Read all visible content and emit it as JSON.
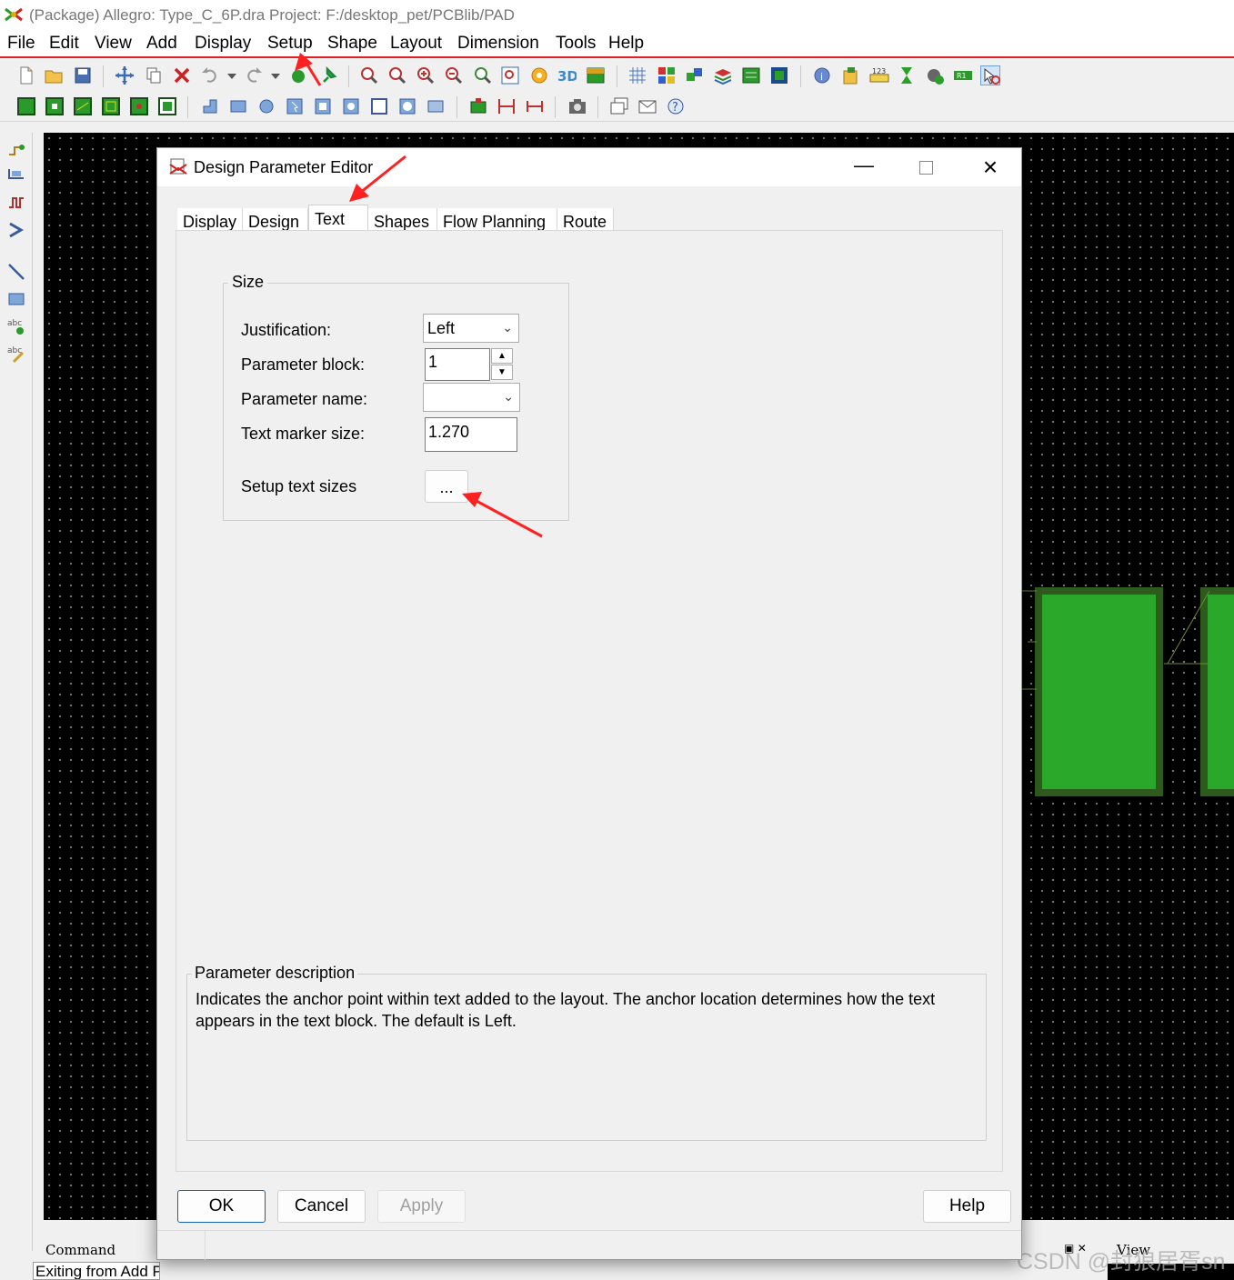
{
  "window": {
    "title": "(Package) Allegro: Type_C_6P.dra  Project: F:/desktop_pet/PCBlib/PAD"
  },
  "menu": [
    "File",
    "Edit",
    "View",
    "Add",
    "Display",
    "Setup",
    "Shape",
    "Layout",
    "Dimension",
    "Tools",
    "Help"
  ],
  "dialog": {
    "title": "Design Parameter Editor",
    "tabs": [
      "Display",
      "Design",
      "Text",
      "Shapes",
      "Flow Planning",
      "Route"
    ],
    "active_tab": "Text",
    "size_group": {
      "title": "Size",
      "justification_label": "Justification:",
      "justification_value": "Left",
      "parameter_block_label": "Parameter block:",
      "parameter_block_value": "1",
      "parameter_name_label": "Parameter name:",
      "parameter_name_value": "",
      "text_marker_size_label": "Text marker size:",
      "text_marker_size_value": "1.270",
      "setup_text_sizes_label": "Setup text sizes",
      "setup_text_sizes_button": "..."
    },
    "description": {
      "title": "Parameter description",
      "text": "Indicates the anchor point within text added to the layout. The anchor location determines how the text appears in the text block. The default is Left."
    },
    "buttons": {
      "ok": "OK",
      "cancel": "Cancel",
      "apply": "Apply",
      "help": "Help"
    }
  },
  "command_panel": {
    "label": "Command",
    "output": "Exiting from Add Pin"
  },
  "view_panel": {
    "label": "View"
  },
  "watermark": "CSDN @封狼居胥sn",
  "colors": {
    "annotation_arrow": "#ff2020",
    "pad_fill": "#2aa82a",
    "pad_border": "#2e5a1e",
    "canvas": "#000000",
    "menu_underline": "#e02020"
  }
}
